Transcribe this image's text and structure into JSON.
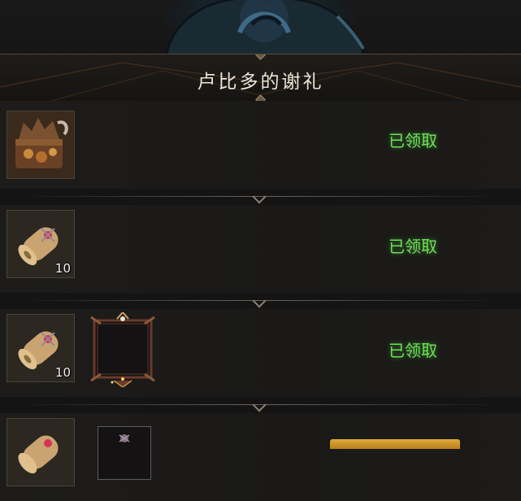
{
  "header": {
    "title": "卢比多的谢礼"
  },
  "rewards": [
    {
      "icon": "treasure-chest-icon",
      "qty": "",
      "status": "已领取"
    },
    {
      "icon": "scroll-icon",
      "qty": "10",
      "status": "已领取"
    },
    {
      "icon": "scroll-icon",
      "qty": "10",
      "extra_icon": "portrait-frame-icon",
      "status": "已领取"
    },
    {
      "icon": "scroll-icon",
      "qty": "",
      "extra_icon": "portrait-frame-icon",
      "status": ""
    }
  ],
  "colors": {
    "claimed": "#6fe05a",
    "accent_gold": "#d9a23a"
  }
}
